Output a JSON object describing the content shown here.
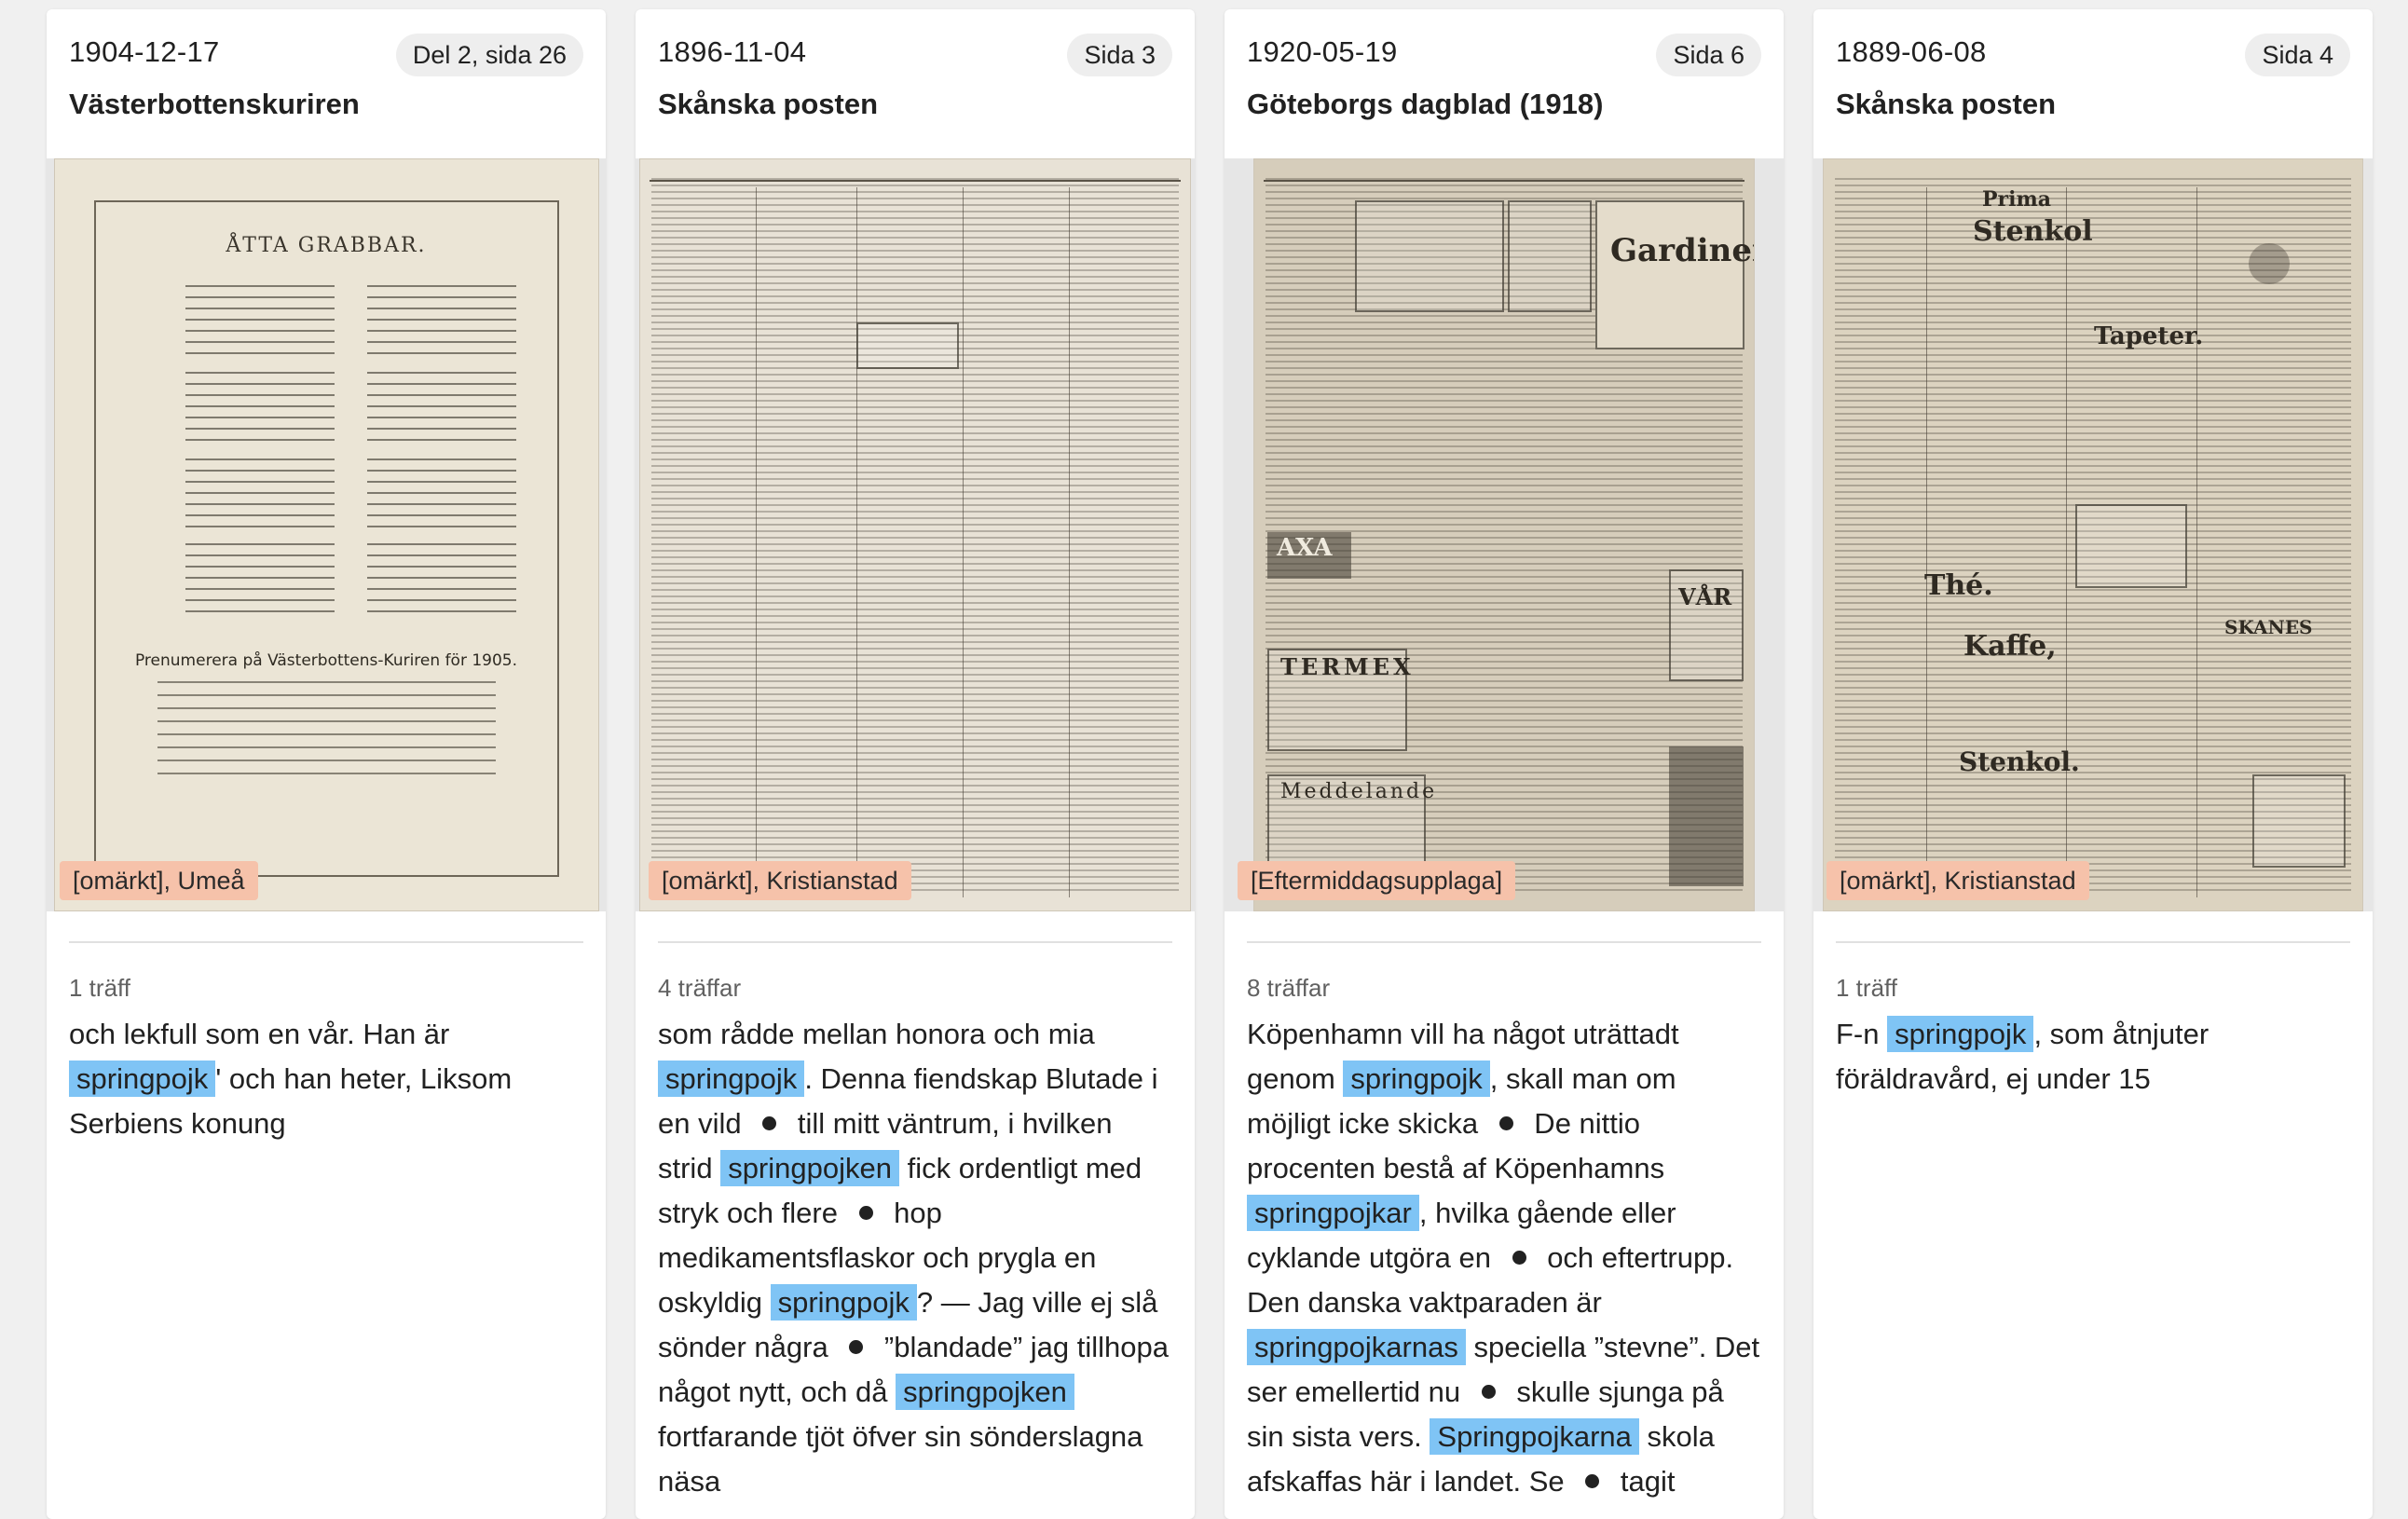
{
  "cards": [
    {
      "date": "1904-12-17",
      "page": "Del 2, sida 26",
      "title": "Västerbottenskuriren",
      "tag": "[omärkt], Umeå",
      "hits": "1 träff",
      "thumb": {
        "heading": "ÅTTA GRABBAR.",
        "subheading": "Prenumerera på Västerbottens-Kuriren för 1905."
      },
      "snippet": [
        {
          "t": "och lekfull som en vår. Han är "
        },
        {
          "h": "springpojk"
        },
        {
          "t": "' och han heter, Liksom Serbiens konung"
        }
      ]
    },
    {
      "date": "1896-11-04",
      "page": "Sida 3",
      "title": "Skånska posten",
      "tag": "[omärkt], Kristianstad",
      "hits": "4 träffar",
      "snippet": [
        {
          "t": "som rådde mellan honora och mia "
        },
        {
          "h": "springpojk"
        },
        {
          "t": ". Denna fiendskap Blutade i en vild "
        },
        {
          "dot": true
        },
        {
          "t": " till mitt väntrum, i hvilken strid "
        },
        {
          "h": "springpojken"
        },
        {
          "t": " fick ordentligt med stryk och flere "
        },
        {
          "dot": true
        },
        {
          "t": " hop medikamentsflaskor och prygla en oskyldig "
        },
        {
          "h": "springpojk"
        },
        {
          "t": "? — Jag ville ej slå sönder några "
        },
        {
          "dot": true
        },
        {
          "t": " ”blandade” jag tillhopa något nytt, och då "
        },
        {
          "h": "springpojken"
        },
        {
          "t": " fortfarande tjöt öfver sin sönderslagna näsa"
        }
      ]
    },
    {
      "date": "1920-05-19",
      "page": "Sida 6",
      "title": "Göteborgs dagblad (1918)",
      "tag": "[Eftermiddagsupplaga]",
      "hits": "8 träffar",
      "thumb": {
        "words": [
          "Gardiner",
          "AXA",
          "TERMEX",
          "Meddelande",
          "VÅR"
        ]
      },
      "snippet": [
        {
          "t": "Köpenhamn vill ha något uträttadt genom "
        },
        {
          "h": "springpojk"
        },
        {
          "t": ", skall man om möjligt icke skicka "
        },
        {
          "dot": true
        },
        {
          "t": " De nittio procenten bestå af Köpenhamns "
        },
        {
          "h": "springpojkar"
        },
        {
          "t": ", hvilka gående eller cyklande utgöra en "
        },
        {
          "dot": true
        },
        {
          "t": " och eftertrupp. Den danska vaktparaden är "
        },
        {
          "h": "springpojkarnas"
        },
        {
          "t": " speciella ”stevne”. Det ser emellertid nu "
        },
        {
          "dot": true
        },
        {
          "t": " skulle sjunga på sin sista vers. "
        },
        {
          "h": "Springpojkarna"
        },
        {
          "t": " skola afskaffas här i landet. Se "
        },
        {
          "dot": true
        },
        {
          "t": " tagit"
        }
      ]
    },
    {
      "date": "1889-06-08",
      "page": "Sida 4",
      "title": "Skånska posten",
      "tag": "[omärkt], Kristianstad",
      "hits": "1 träff",
      "thumb": {
        "words": [
          "Prima",
          "Stenkol",
          "Tapeter.",
          "Thé.",
          "Kaffe,",
          "Stenkol.",
          "SKANES"
        ]
      },
      "snippet": [
        {
          "t": "F-n "
        },
        {
          "h": "springpojk"
        },
        {
          "t": ", som åtnjuter föräldravård, ej under 15"
        }
      ]
    }
  ]
}
